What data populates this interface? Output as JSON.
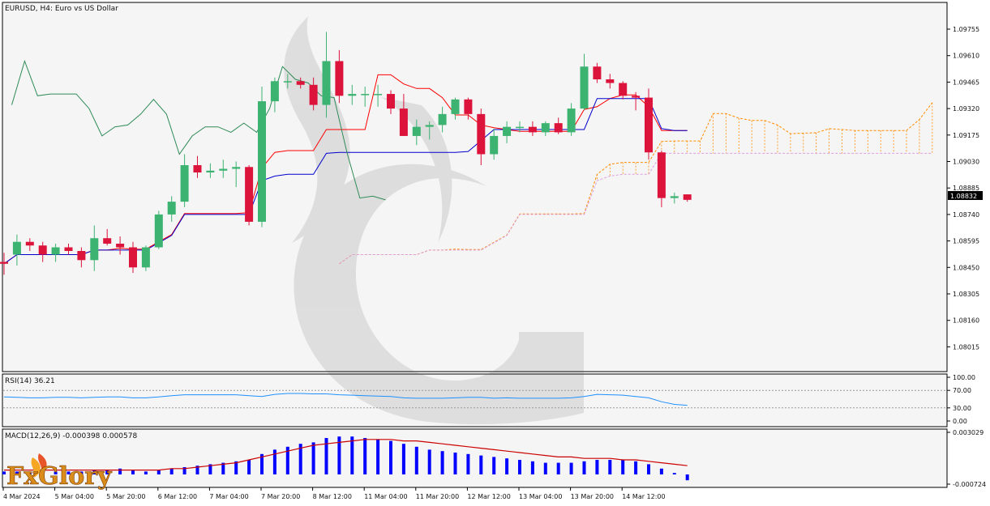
{
  "header": {
    "title": "EURUSD, H4:  Euro vs US Dollar"
  },
  "price": {
    "yticks": [
      "1.09755",
      "1.09610",
      "1.09465",
      "1.09320",
      "1.09175",
      "1.09030",
      "1.08885",
      "1.08740",
      "1.08595",
      "1.08450",
      "1.08305",
      "1.08160",
      "1.08015"
    ],
    "current": "1.08832"
  },
  "rsi": {
    "label": "RSI(14) 36.21",
    "yticks": [
      "100.00",
      "70.00",
      "30.00",
      "0.00"
    ],
    "levels": [
      70,
      30
    ]
  },
  "macd": {
    "label": "MACD(12,26,9) -0.000398 0.000578",
    "yticks": [
      "0.003029",
      "-0.000724"
    ]
  },
  "xaxis": {
    "labels": [
      "4 Mar 2024",
      "5 Mar 04:00",
      "5 Mar 20:00",
      "6 Mar 12:00",
      "7 Mar 04:00",
      "7 Mar 20:00",
      "8 Mar 12:00",
      "11 Mar 04:00",
      "11 Mar 20:00",
      "12 Mar 12:00",
      "13 Mar 04:00",
      "13 Mar 20:00",
      "14 Mar 12:00"
    ]
  },
  "logo": {
    "text": "FxGlory"
  },
  "colors": {
    "bull": "#3cb371",
    "bear": "#dc143c",
    "tenkan": "#ff0000",
    "kijun": "#0000cd",
    "chikou": "#2e8b57",
    "spanA": "#ff8c00",
    "spanB": "#dda0dd",
    "rsi": "#1e90ff",
    "macdHist": "#0000ff",
    "macdSignal": "#cc0000"
  },
  "chart_data": {
    "type": "candlestick",
    "symbol": "EURUSD",
    "timeframe": "H4",
    "ylim": [
      1.0795,
      1.099
    ],
    "candles": [
      {
        "o": 1.0848,
        "h": 1.0853,
        "l": 1.0841,
        "c": 1.0847
      },
      {
        "o": 1.0852,
        "h": 1.0863,
        "l": 1.0846,
        "c": 1.0859
      },
      {
        "o": 1.0859,
        "h": 1.0861,
        "l": 1.0854,
        "c": 1.0857
      },
      {
        "o": 1.0857,
        "h": 1.0859,
        "l": 1.0848,
        "c": 1.0852
      },
      {
        "o": 1.0852,
        "h": 1.0858,
        "l": 1.0848,
        "c": 1.0856
      },
      {
        "o": 1.0856,
        "h": 1.0858,
        "l": 1.0852,
        "c": 1.0854
      },
      {
        "o": 1.0854,
        "h": 1.0856,
        "l": 1.0845,
        "c": 1.0849
      },
      {
        "o": 1.0849,
        "h": 1.0868,
        "l": 1.0843,
        "c": 1.0861
      },
      {
        "o": 1.0861,
        "h": 1.0866,
        "l": 1.0857,
        "c": 1.0858
      },
      {
        "o": 1.0858,
        "h": 1.0862,
        "l": 1.0852,
        "c": 1.0856
      },
      {
        "o": 1.0856,
        "h": 1.0859,
        "l": 1.0842,
        "c": 1.0845
      },
      {
        "o": 1.0845,
        "h": 1.0857,
        "l": 1.0843,
        "c": 1.0856
      },
      {
        "o": 1.0856,
        "h": 1.0876,
        "l": 1.0855,
        "c": 1.0874
      },
      {
        "o": 1.0874,
        "h": 1.0884,
        "l": 1.087,
        "c": 1.0881
      },
      {
        "o": 1.0881,
        "h": 1.0907,
        "l": 1.0878,
        "c": 1.0901
      },
      {
        "o": 1.0901,
        "h": 1.0906,
        "l": 1.0894,
        "c": 1.0897
      },
      {
        "o": 1.0897,
        "h": 1.0902,
        "l": 1.0894,
        "c": 1.0898
      },
      {
        "o": 1.0898,
        "h": 1.0904,
        "l": 1.0894,
        "c": 1.0899
      },
      {
        "o": 1.0899,
        "h": 1.0903,
        "l": 1.0889,
        "c": 1.09
      },
      {
        "o": 1.09,
        "h": 1.0901,
        "l": 1.0868,
        "c": 1.087
      },
      {
        "o": 1.087,
        "h": 1.0944,
        "l": 1.0867,
        "c": 1.0936
      },
      {
        "o": 1.0936,
        "h": 1.0949,
        "l": 1.093,
        "c": 1.0947
      },
      {
        "o": 1.0947,
        "h": 1.0951,
        "l": 1.0943,
        "c": 1.0947
      },
      {
        "o": 1.0947,
        "h": 1.0949,
        "l": 1.0943,
        "c": 1.0945
      },
      {
        "o": 1.0945,
        "h": 1.0949,
        "l": 1.0931,
        "c": 1.0934
      },
      {
        "o": 1.0934,
        "h": 1.0974,
        "l": 1.0927,
        "c": 1.0958
      },
      {
        "o": 1.0958,
        "h": 1.0964,
        "l": 1.0935,
        "c": 1.0939
      },
      {
        "o": 1.0939,
        "h": 1.0945,
        "l": 1.0934,
        "c": 1.094
      },
      {
        "o": 1.094,
        "h": 1.0944,
        "l": 1.0933,
        "c": 1.094
      },
      {
        "o": 1.094,
        "h": 1.0945,
        "l": 1.0933,
        "c": 1.094
      },
      {
        "o": 1.094,
        "h": 1.0942,
        "l": 1.0929,
        "c": 1.0932
      },
      {
        "o": 1.0932,
        "h": 1.094,
        "l": 1.0917,
        "c": 1.0917
      },
      {
        "o": 1.0917,
        "h": 1.0926,
        "l": 1.0912,
        "c": 1.0922
      },
      {
        "o": 1.0922,
        "h": 1.0925,
        "l": 1.0915,
        "c": 1.0923
      },
      {
        "o": 1.0923,
        "h": 1.0933,
        "l": 1.0919,
        "c": 1.0929
      },
      {
        "o": 1.0929,
        "h": 1.0938,
        "l": 1.0926,
        "c": 1.0937
      },
      {
        "o": 1.0937,
        "h": 1.0938,
        "l": 1.0926,
        "c": 1.0929
      },
      {
        "o": 1.0929,
        "h": 1.0932,
        "l": 1.0901,
        "c": 1.0907
      },
      {
        "o": 1.0907,
        "h": 1.0921,
        "l": 1.0904,
        "c": 1.0917
      },
      {
        "o": 1.0917,
        "h": 1.0925,
        "l": 1.0913,
        "c": 1.0922
      },
      {
        "o": 1.0922,
        "h": 1.0925,
        "l": 1.0919,
        "c": 1.0922
      },
      {
        "o": 1.0922,
        "h": 1.0925,
        "l": 1.0917,
        "c": 1.0919
      },
      {
        "o": 1.0919,
        "h": 1.0925,
        "l": 1.0917,
        "c": 1.0924
      },
      {
        "o": 1.0924,
        "h": 1.0927,
        "l": 1.0918,
        "c": 1.0919
      },
      {
        "o": 1.0919,
        "h": 1.0935,
        "l": 1.0917,
        "c": 1.0932
      },
      {
        "o": 1.0932,
        "h": 1.0962,
        "l": 1.0931,
        "c": 1.0955
      },
      {
        "o": 1.0955,
        "h": 1.0957,
        "l": 1.0946,
        "c": 1.0948
      },
      {
        "o": 1.0948,
        "h": 1.0951,
        "l": 1.0943,
        "c": 1.0946
      },
      {
        "o": 1.0946,
        "h": 1.0947,
        "l": 1.0937,
        "c": 1.0939
      },
      {
        "o": 1.0939,
        "h": 1.0941,
        "l": 1.0931,
        "c": 1.0938
      },
      {
        "o": 1.0938,
        "h": 1.0943,
        "l": 1.0904,
        "c": 1.0908
      },
      {
        "o": 1.0908,
        "h": 1.0909,
        "l": 1.0878,
        "c": 1.0883
      },
      {
        "o": 1.0883,
        "h": 1.0886,
        "l": 1.088,
        "c": 1.0884
      },
      {
        "o": 1.0885,
        "h": 1.0885,
        "l": 1.0881,
        "c": 1.0882
      }
    ],
    "rsi": [
      55,
      54,
      53,
      53,
      54,
      54,
      53,
      54,
      55,
      55,
      53,
      53,
      55,
      58,
      60,
      60,
      60,
      60,
      60,
      58,
      56,
      61,
      63,
      63,
      62,
      62,
      60,
      59,
      58,
      57,
      56,
      53,
      52,
      52,
      52,
      53,
      54,
      54,
      52,
      53,
      52,
      52,
      52,
      52,
      53,
      56,
      61,
      60,
      59,
      56,
      53,
      44,
      38,
      36
    ],
    "macd_hist": [
      0.0002,
      0.0002,
      0.0001,
      0.0002,
      0.0002,
      0.0002,
      0.0002,
      0.0003,
      0.0003,
      0.0004,
      0.0003,
      0.0002,
      0.0003,
      0.0004,
      0.0005,
      0.0006,
      0.0007,
      0.0008,
      0.0009,
      0.001,
      0.0014,
      0.0017,
      0.0019,
      0.0021,
      0.0022,
      0.0025,
      0.0026,
      0.0026,
      0.0025,
      0.0024,
      0.0023,
      0.0021,
      0.0019,
      0.0017,
      0.0016,
      0.0015,
      0.0014,
      0.0013,
      0.0012,
      0.0011,
      0.001,
      0.0009,
      0.0008,
      0.0008,
      0.0008,
      0.0009,
      0.001,
      0.001,
      0.001,
      0.0009,
      0.0007,
      0.0004,
      0.0001,
      -0.0004
    ],
    "macd_signal": [
      0.0003,
      0.0003,
      0.0003,
      0.0003,
      0.0003,
      0.0003,
      0.0003,
      0.0003,
      0.0003,
      0.0003,
      0.0003,
      0.0003,
      0.0003,
      0.0004,
      0.0004,
      0.0005,
      0.0006,
      0.0007,
      0.0008,
      0.001,
      0.0012,
      0.0014,
      0.0016,
      0.0018,
      0.002,
      0.0021,
      0.0022,
      0.0023,
      0.0024,
      0.0024,
      0.0024,
      0.0023,
      0.0023,
      0.0022,
      0.0021,
      0.002,
      0.0019,
      0.0018,
      0.0017,
      0.0016,
      0.0015,
      0.0014,
      0.0013,
      0.0012,
      0.0012,
      0.0011,
      0.0011,
      0.0011,
      0.001,
      0.001,
      0.0009,
      0.0008,
      0.0007,
      0.0006
    ]
  }
}
